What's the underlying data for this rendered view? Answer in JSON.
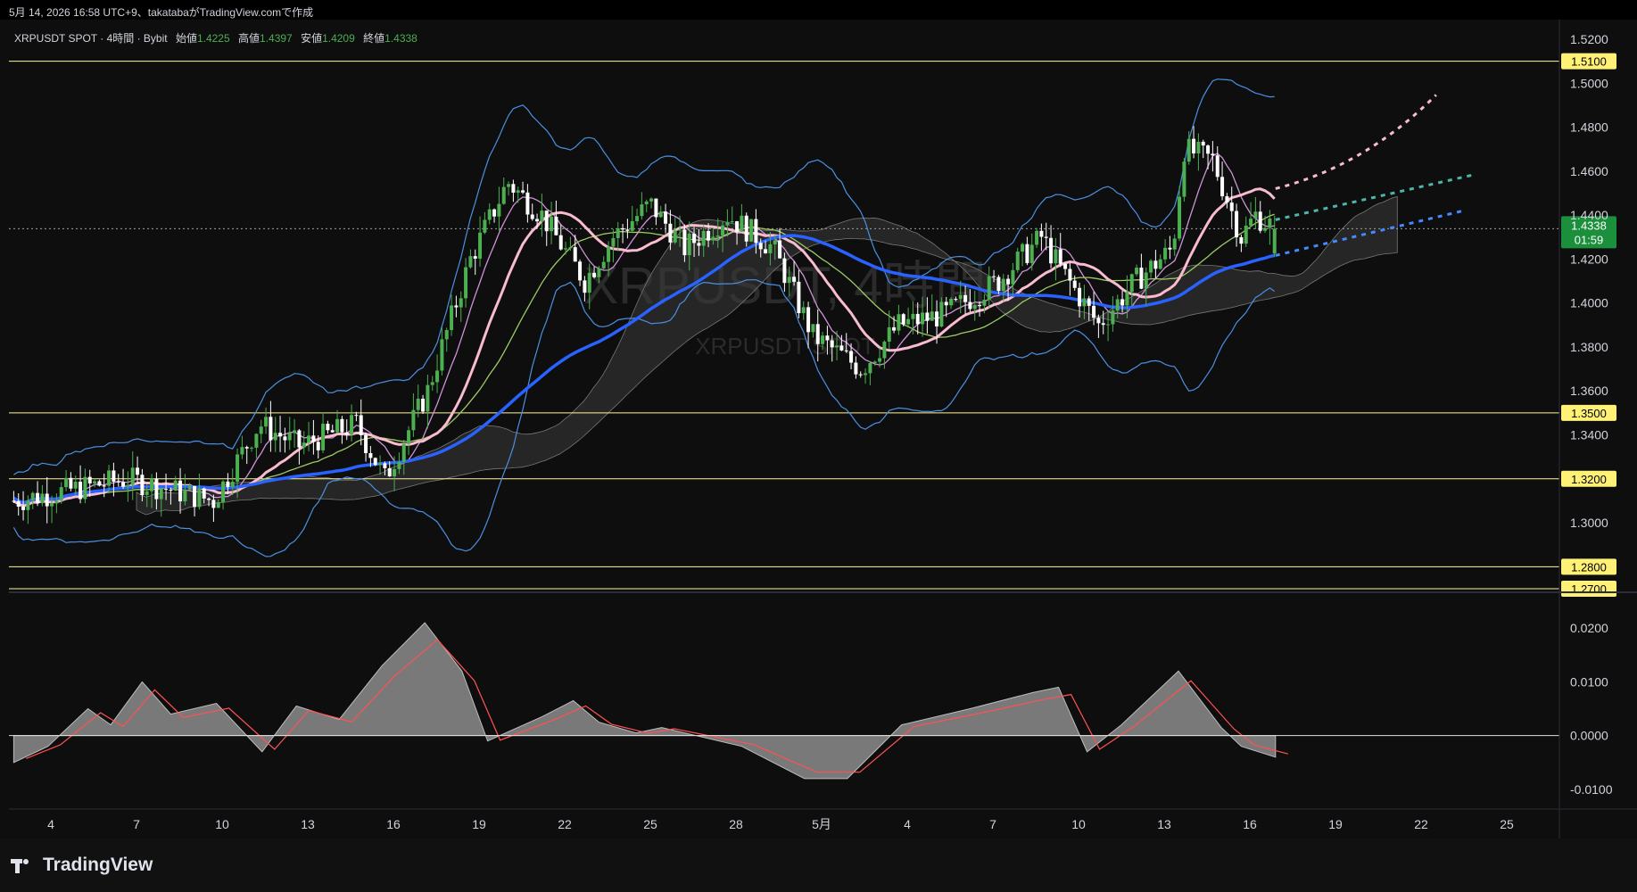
{
  "caption": "5月 14, 2026 16:58 UTC+9、takatabaがTradingView.comで作成",
  "watermark": {
    "symbol": "XRPUSDT, 4時間",
    "sub": "XRPUSDT SPOT"
  },
  "legend": {
    "symbol": "XRPUSDT SPOT · 4時間 · Bybit",
    "open_label": "始値",
    "open": "1.4225",
    "high_label": "高値",
    "high": "1.4397",
    "low_label": "安値",
    "low": "1.4209",
    "close_label": "終値",
    "close": "1.4338"
  },
  "price_axis": {
    "ticks": [
      "1.5200",
      "1.5000",
      "1.4800",
      "1.4600",
      "1.4400",
      "1.4200",
      "1.4000",
      "1.3800",
      "1.3600",
      "1.3400",
      "1.3000"
    ],
    "current": {
      "price": "1.4338",
      "countdown": "01:59"
    }
  },
  "horizontal_levels": [
    "1.5100",
    "1.3500",
    "1.3200",
    "1.2800",
    "1.2700"
  ],
  "time_axis": [
    "4",
    "7",
    "10",
    "13",
    "16",
    "19",
    "22",
    "25",
    "28",
    "5月",
    "4",
    "7",
    "10",
    "13",
    "16",
    "19",
    "22",
    "25"
  ],
  "oscillator_axis": [
    "0.0200",
    "0.0100",
    "0.0000",
    "-0.0100"
  ],
  "brand": "TradingView",
  "colors": {
    "up": "#4caf50",
    "down": "#ffffff",
    "ma_long": "#2962ff",
    "ma_mid": "#f8bbd0",
    "bb": "#4a90e2",
    "hline": "#fff59d",
    "osc_fill": "#8c8c8c",
    "osc_signal": "#ff5252",
    "cloud": "#3a3a3a",
    "price_tag": "#1b8f3c"
  },
  "chart_data": {
    "type": "candlestick",
    "title": "XRPUSDT SPOT · 4時間 · Bybit",
    "ylim": [
      1.27,
      1.525
    ],
    "x_range_days": [
      "4",
      "25"
    ],
    "last": {
      "open": 1.4225,
      "high": 1.4397,
      "low": 1.4209,
      "close": 1.4338
    },
    "levels": [
      1.51,
      1.35,
      1.32,
      1.28,
      1.27
    ],
    "price_path": [
      [
        0,
        1.31
      ],
      [
        4,
        1.32
      ],
      [
        7,
        1.31
      ],
      [
        8.6,
        1.345
      ],
      [
        10,
        1.335
      ],
      [
        12,
        1.345
      ],
      [
        13,
        1.32
      ],
      [
        14.5,
        1.36
      ],
      [
        16,
        1.42
      ],
      [
        17.3,
        1.455
      ],
      [
        18.5,
        1.44
      ],
      [
        20,
        1.41
      ],
      [
        21,
        1.43
      ],
      [
        22.3,
        1.445
      ],
      [
        23.5,
        1.425
      ],
      [
        25,
        1.44
      ],
      [
        26.6,
        1.425
      ],
      [
        28,
        1.385
      ],
      [
        29.7,
        1.37
      ],
      [
        31,
        1.39
      ],
      [
        32.6,
        1.395
      ],
      [
        34.5,
        1.41
      ],
      [
        36,
        1.43
      ],
      [
        36.7,
        1.415
      ],
      [
        38,
        1.39
      ],
      [
        39.3,
        1.41
      ],
      [
        40.6,
        1.425
      ],
      [
        41,
        1.47
      ],
      [
        42,
        1.465
      ],
      [
        43,
        1.43
      ],
      [
        43.5,
        1.44
      ],
      [
        44.2,
        1.4338
      ]
    ],
    "oscillator": {
      "ylim": [
        -0.012,
        0.024
      ],
      "points": [
        [
          0,
          -0.005
        ],
        [
          1.2,
          -0.002
        ],
        [
          2.6,
          0.005
        ],
        [
          3.4,
          0.002
        ],
        [
          4.5,
          0.01
        ],
        [
          5.5,
          0.004
        ],
        [
          7.1,
          0.006
        ],
        [
          8.7,
          -0.003
        ],
        [
          9.9,
          0.0055
        ],
        [
          11.4,
          0.003
        ],
        [
          12.9,
          0.013
        ],
        [
          14.4,
          0.021
        ],
        [
          15.7,
          0.012
        ],
        [
          16.6,
          -0.001
        ],
        [
          18.5,
          0.0035
        ],
        [
          19.6,
          0.0065
        ],
        [
          20.5,
          0.0025
        ],
        [
          21.8,
          0.0005
        ],
        [
          22.7,
          0.0015
        ],
        [
          25.5,
          -0.002
        ],
        [
          27.7,
          -0.008
        ],
        [
          29.2,
          -0.008
        ],
        [
          31.1,
          0.002
        ],
        [
          33.5,
          0.005
        ],
        [
          35.7,
          0.008
        ],
        [
          36.6,
          0.009
        ],
        [
          37.6,
          -0.003
        ],
        [
          38.8,
          0.002
        ],
        [
          40.8,
          0.012
        ],
        [
          42.3,
          0.0015
        ],
        [
          43,
          -0.002
        ],
        [
          44.2,
          -0.004
        ]
      ]
    }
  }
}
